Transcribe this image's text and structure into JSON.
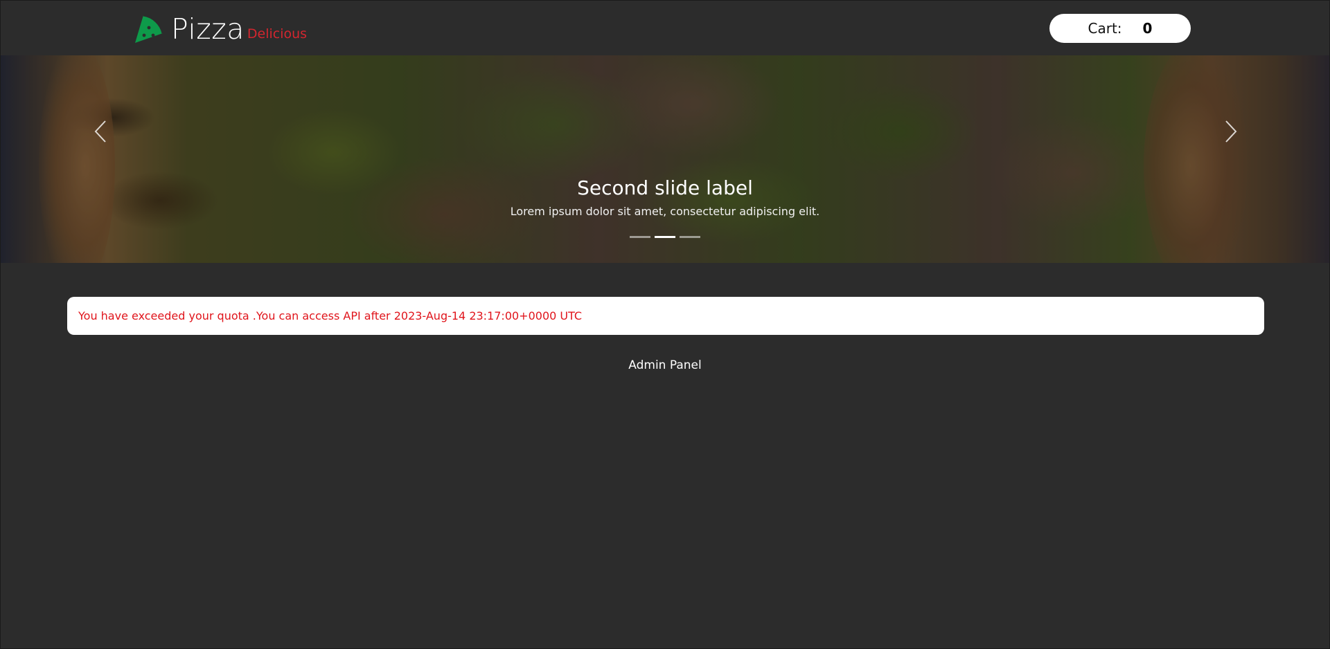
{
  "header": {
    "brand_name": "Pizza",
    "brand_tagline": "Delicious",
    "logo_icon": "pizza-slice-icon",
    "brand_color": "#0e9a4a",
    "tagline_color": "#d3262f",
    "cart_label": "Cart:",
    "cart_count": "0"
  },
  "carousel": {
    "prev_icon": "chevron-left-icon",
    "next_icon": "chevron-right-icon",
    "caption_title": "Second slide label",
    "caption_text": "Lorem ipsum dolor sit amet, consectetur adipiscing elit.",
    "slides_total": 3,
    "active_slide": 2
  },
  "alert": {
    "message": "You have exceeded your quota .You can access API after 2023-Aug-14 23:17:00+0000 UTC",
    "text_color": "#e0141b"
  },
  "footer": {
    "admin_link": "Admin Panel"
  }
}
